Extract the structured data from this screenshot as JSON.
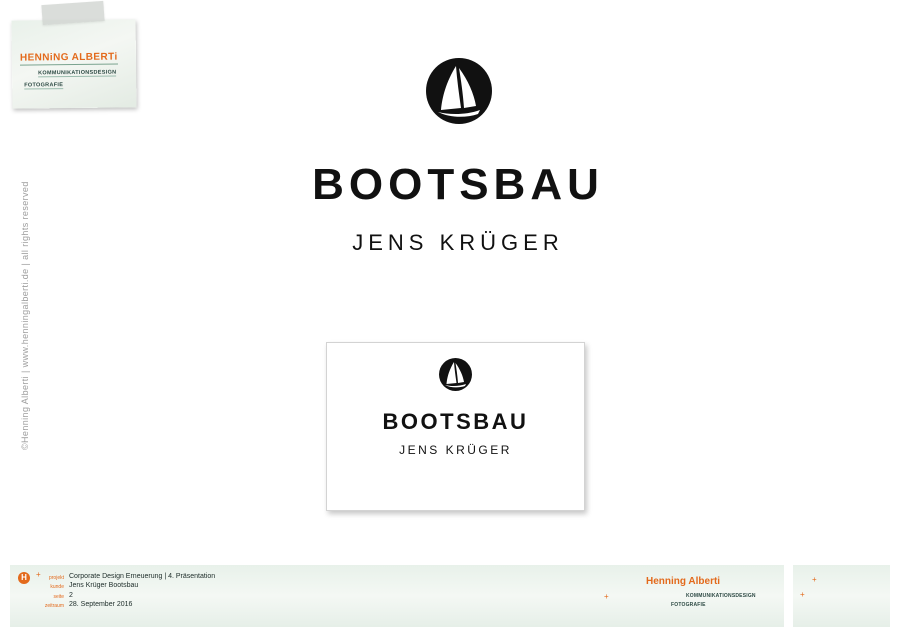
{
  "sticker": {
    "name": "HENNiNG ALBERTi",
    "line1": "KOMMUNIKATIONSDESIGN",
    "line2": "FOTOGRAFIE"
  },
  "copyright": "©Henning Alberti  |  www.henningalberti.de  |  all rights reserved",
  "logo": {
    "title": "BOOTSBAU",
    "subtitle": "JENS KRÜGER"
  },
  "card": {
    "title": "BOOTSBAU",
    "subtitle": "JENS KRÜGER"
  },
  "footer": {
    "badge": "H",
    "rows": [
      {
        "label": "projekt",
        "value": "Corporate Design Erneuerung  |  4. Präsentation"
      },
      {
        "label": "kunde",
        "value": "Jens Krüger Bootsbau"
      },
      {
        "label": "seite",
        "value": "2"
      },
      {
        "label": "zeitraum",
        "value": "28. September 2016"
      }
    ],
    "brand_name": "Henning Alberti",
    "brand_line1": "KOMMUNIKATIONSDESIGN",
    "brand_line2": "FOTOGRAFIE"
  },
  "colors": {
    "accent": "#e36a1c",
    "logo": "#111111",
    "panel": "#eaf2ec"
  }
}
